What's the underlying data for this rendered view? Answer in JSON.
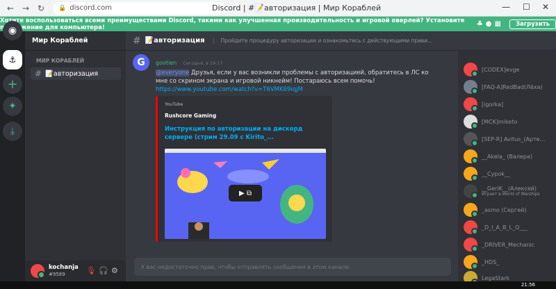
{
  "browser": {
    "url": "discord.com",
    "title": "Discord | #📝авторизация | Мир Кораблей",
    "window_controls": [
      "—",
      "☐",
      "✕"
    ]
  },
  "notice": {
    "text": "Хотите воспользоваться всеми преимуществами Discord, такими как улучшенная производительность и игровой оверлей? Установите приложение для компьютера!",
    "button": "Загрузить"
  },
  "server": {
    "name": "Мир Кораблей",
    "category": "МИР КОРАБЛЕЙ",
    "channel": "📝авторизация"
  },
  "user": {
    "name": "kochanja",
    "tag": "#9589"
  },
  "channel_header": {
    "name": "📝авторизация",
    "topic": "Пройдите процедуру авторизации и ознакомьтесь с действующими прави..."
  },
  "message": {
    "avatar_letter": "G",
    "author": "gootien",
    "timestamp": "Сегодня, в 19:17",
    "mention": "@everyone",
    "text": " Друзья, если у вас возникли проблемы с авторизацией, обратитесь в ЛС ко мне со скрином экрана и игровой никнейм! Постараюсь всем помочь!",
    "link": "https://www.youtube.com/watch?v=T6VMK69iqjM",
    "embed": {
      "provider": "YouTube",
      "author": "Rushcore Gaming",
      "title": "Инструкция по авторизации на дискорд сервере (стрим 29.09 с Kirito_..."
    }
  },
  "input_placeholder": "У вас недостаточно прав, чтобы отправлять сообщения в этом канале.",
  "members": [
    {
      "name": "[CODEX]evge",
      "color": "#f04747",
      "activity": ""
    },
    {
      "name": "[FAQ-A]RedBad(Лёха)",
      "color": "#747f8d",
      "activity": ""
    },
    {
      "name": "[igorka]",
      "color": "#f04747",
      "activity": ""
    },
    {
      "name": "[MCK]miketo",
      "color": "#dddddd",
      "activity": ""
    },
    {
      "name": "[SEP-R] Avitus_(Арте...",
      "color": "#555555",
      "activity": ""
    },
    {
      "name": "__Akela_ (Валера)",
      "color": "#faa61a",
      "activity": ""
    },
    {
      "name": "__Cypok__",
      "color": "#faa61a",
      "activity": ""
    },
    {
      "name": "__GeriK__(Алексей)",
      "color": "#444444",
      "activity": "Играет в World of Warships"
    },
    {
      "name": "_asmo (Сергей)",
      "color": "#faa61a",
      "activity": ""
    },
    {
      "name": "_D_I_A_B_L_O___",
      "color": "#f04747",
      "activity": ""
    },
    {
      "name": "_DRIVER_Mechanic",
      "color": "#f04747",
      "activity": ""
    },
    {
      "name": "_HDS_",
      "color": "#faa61a",
      "activity": ""
    },
    {
      "name": "LegaStark",
      "color": "#ccaa33",
      "activity": ""
    }
  ],
  "taskbar_clock": "21:56"
}
